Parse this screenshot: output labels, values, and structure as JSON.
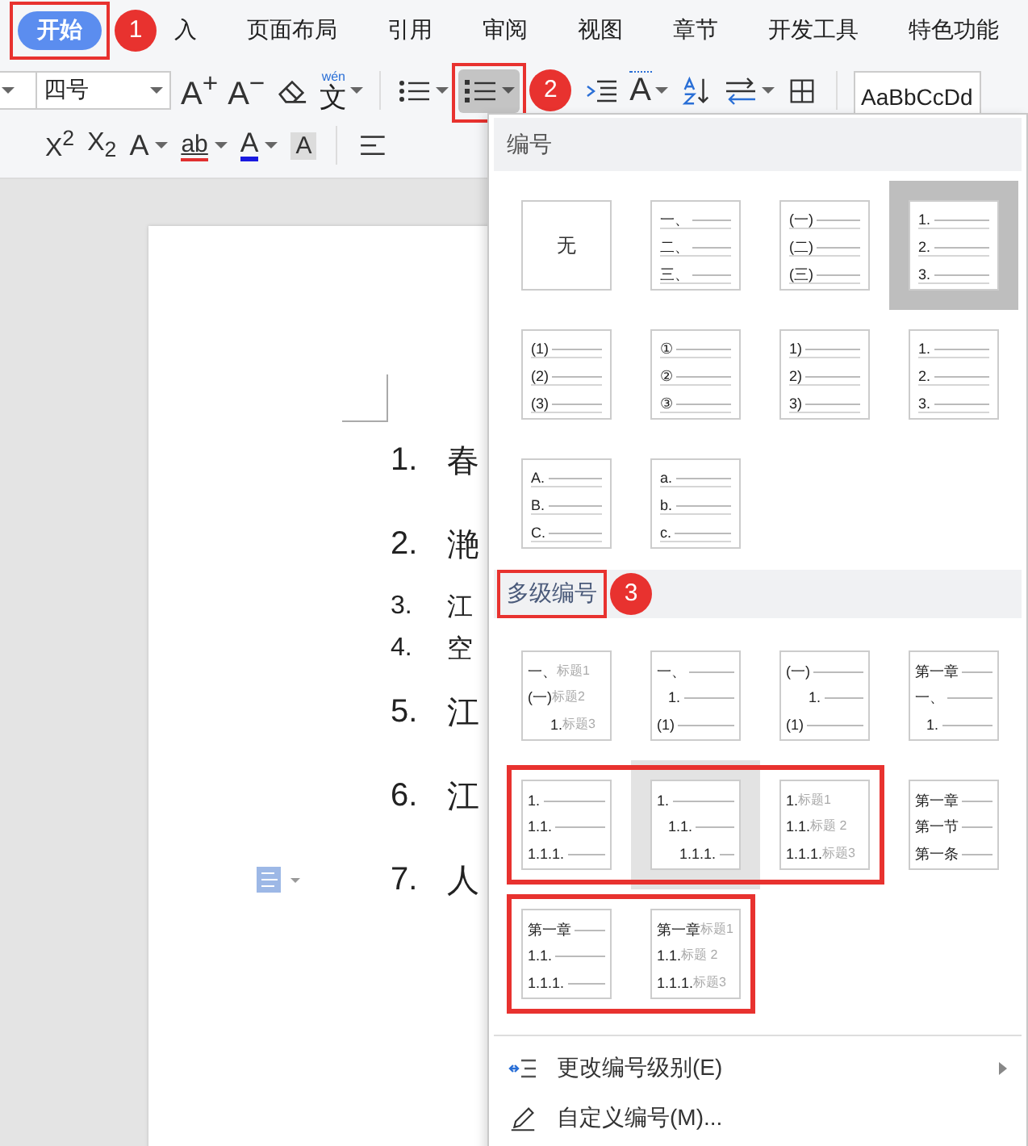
{
  "menu_tabs": [
    {
      "label": "开始",
      "selected": true,
      "annotated": true,
      "badge": "1"
    },
    {
      "label": "入",
      "selected": false,
      "annotated": false
    },
    {
      "label": "页面布局",
      "selected": false,
      "annotated": false
    },
    {
      "label": "引用",
      "selected": false,
      "annotated": false
    },
    {
      "label": "审阅",
      "selected": false,
      "annotated": false
    },
    {
      "label": "视图",
      "selected": false,
      "annotated": false
    },
    {
      "label": "章节",
      "selected": false,
      "annotated": false
    },
    {
      "label": "开发工具",
      "selected": false,
      "annotated": false
    },
    {
      "label": "特色功能",
      "selected": false,
      "annotated": false
    }
  ],
  "toolbar": {
    "font_size": "四号",
    "grow_font": "A$^{+}$",
    "shrink_font": "A$^{−}$",
    "pinyin": {
      "ruby": "wén",
      "text": "文"
    },
    "numbered_list": {
      "selected": true,
      "annotated": true,
      "badge": "2"
    },
    "text_direction": "A",
    "style_preview": "AaBbCcDd",
    "superscript": "X$^{2}$",
    "subscript": "X$_{2}$",
    "text_effect": "A",
    "highlight": "ab",
    "font_color": "A",
    "char_shading": "A"
  },
  "document": {
    "items": [
      {
        "number": "1.",
        "text": "春",
        "kind": "large",
        "handle": false
      },
      {
        "number": "2.",
        "text": "滟",
        "kind": "large",
        "handle": false
      },
      {
        "number": "3.",
        "text": "江",
        "kind": "small",
        "handle": false
      },
      {
        "number": "4.",
        "text": "空",
        "kind": "small",
        "handle": false
      },
      {
        "number": "5.",
        "text": "江",
        "kind": "large",
        "handle": false
      },
      {
        "number": "6.",
        "text": "江",
        "kind": "large",
        "handle": false
      },
      {
        "number": "7.",
        "text": "人",
        "kind": "large",
        "handle": true
      }
    ]
  },
  "numbering_menu": {
    "numbering_heading": "编号",
    "numbering_tiles": [
      {
        "kind": "none",
        "label": "无",
        "selected": false
      },
      {
        "kind": "list",
        "selected": false,
        "lines": [
          {
            "label": "一、",
            "kind": "level1"
          },
          {
            "label": "二、",
            "kind": "level1"
          },
          {
            "label": "三、",
            "kind": "level1"
          }
        ]
      },
      {
        "kind": "list",
        "selected": false,
        "lines": [
          {
            "label": "(一)",
            "kind": "level1"
          },
          {
            "label": "(二)",
            "kind": "level1"
          },
          {
            "label": "(三)",
            "kind": "level1"
          }
        ]
      },
      {
        "kind": "list",
        "selected": true,
        "lines": [
          {
            "label": "1.",
            "kind": "level1"
          },
          {
            "label": "2.",
            "kind": "level1"
          },
          {
            "label": "3.",
            "kind": "level1"
          }
        ]
      },
      {
        "kind": "list",
        "selected": false,
        "lines": [
          {
            "label": "(1)",
            "kind": "level1"
          },
          {
            "label": "(2)",
            "kind": "level1"
          },
          {
            "label": "(3)",
            "kind": "level1"
          }
        ]
      },
      {
        "kind": "list",
        "selected": false,
        "lines": [
          {
            "label": "①",
            "kind": "level1"
          },
          {
            "label": "②",
            "kind": "level1"
          },
          {
            "label": "③",
            "kind": "level1"
          }
        ]
      },
      {
        "kind": "list",
        "selected": false,
        "lines": [
          {
            "label": "1)",
            "kind": "level1"
          },
          {
            "label": "2)",
            "kind": "level1"
          },
          {
            "label": "3)",
            "kind": "level1"
          }
        ]
      },
      {
        "kind": "list",
        "selected": false,
        "lines": [
          {
            "label": "1.",
            "kind": "level1"
          },
          {
            "label": "2.",
            "kind": "level1"
          },
          {
            "label": "3.",
            "kind": "level1"
          }
        ]
      },
      {
        "kind": "list",
        "selected": false,
        "lines": [
          {
            "label": "A.",
            "kind": "level1"
          },
          {
            "label": "B.",
            "kind": "level1"
          },
          {
            "label": "C.",
            "kind": "level1"
          }
        ]
      },
      {
        "kind": "list",
        "selected": false,
        "lines": [
          {
            "label": "a.",
            "kind": "level1"
          },
          {
            "label": "b.",
            "kind": "level1"
          },
          {
            "label": "c.",
            "kind": "level1"
          }
        ]
      }
    ],
    "multilevel_heading": {
      "label": "多级编号",
      "annotated": true,
      "badge": "3"
    },
    "multilevel_rows": [
      {
        "groups": [
          {
            "annotated": false,
            "tiles": [
              {
                "hovered": false,
                "lines": [
                  {
                    "label": "一、",
                    "caption": "标题1",
                    "kind": "level1"
                  },
                  {
                    "label": "(一)",
                    "caption": "标题2",
                    "kind": "level1"
                  },
                  {
                    "label": "1.",
                    "caption": "标题3",
                    "kind": "level3"
                  }
                ]
              },
              {
                "hovered": false,
                "lines": [
                  {
                    "label": "一、",
                    "kind": "level1"
                  },
                  {
                    "label": "1.",
                    "kind": "level2"
                  },
                  {
                    "label": "(1)",
                    "kind": "level1"
                  }
                ]
              },
              {
                "hovered": false,
                "lines": [
                  {
                    "label": "(一)",
                    "kind": "level1"
                  },
                  {
                    "label": "1.",
                    "kind": "level3"
                  },
                  {
                    "label": "(1)",
                    "kind": "level1"
                  }
                ]
              },
              {
                "hovered": false,
                "lines": [
                  {
                    "label": "第一章",
                    "kind": "level1"
                  },
                  {
                    "label": "一、",
                    "kind": "level1"
                  },
                  {
                    "label": "1.",
                    "kind": "level2"
                  }
                ]
              }
            ]
          }
        ]
      },
      {
        "groups": [
          {
            "annotated": true,
            "tiles": [
              {
                "hovered": false,
                "lines": [
                  {
                    "label": "1.",
                    "kind": "level1"
                  },
                  {
                    "label": "1.1.",
                    "kind": "level1"
                  },
                  {
                    "label": "1.1.1.",
                    "kind": "level1"
                  }
                ]
              },
              {
                "hovered": true,
                "lines": [
                  {
                    "label": "1.",
                    "kind": "level1"
                  },
                  {
                    "label": "1.1.",
                    "kind": "level2"
                  },
                  {
                    "label": "1.1.1.",
                    "kind": "level3"
                  }
                ]
              },
              {
                "hovered": false,
                "lines": [
                  {
                    "label": "1.",
                    "caption": "标题1",
                    "kind": "level1"
                  },
                  {
                    "label": "1.1.",
                    "caption": "标题 2",
                    "kind": "level1"
                  },
                  {
                    "label": "1.1.1.",
                    "caption": "标题3",
                    "kind": "level1"
                  }
                ]
              }
            ]
          },
          {
            "annotated": false,
            "tiles": [
              {
                "hovered": false,
                "lines": [
                  {
                    "label": "第一章",
                    "kind": "level1"
                  },
                  {
                    "label": "第一节",
                    "kind": "level1"
                  },
                  {
                    "label": "第一条",
                    "kind": "level1"
                  }
                ]
              }
            ]
          }
        ]
      },
      {
        "groups": [
          {
            "annotated": true,
            "tiles": [
              {
                "hovered": false,
                "lines": [
                  {
                    "label": "第一章",
                    "kind": "level1"
                  },
                  {
                    "label": "1.1.",
                    "kind": "level1"
                  },
                  {
                    "label": "1.1.1.",
                    "kind": "level1"
                  }
                ]
              },
              {
                "hovered": false,
                "lines": [
                  {
                    "label": "第一章",
                    "caption": "标题1",
                    "kind": "level1"
                  },
                  {
                    "label": "1.1.",
                    "caption": "标题 2",
                    "kind": "level1"
                  },
                  {
                    "label": "1.1.1.",
                    "caption": "标题3",
                    "kind": "level1"
                  }
                ]
              }
            ]
          }
        ]
      }
    ],
    "commands": [
      {
        "label": "更改编号级别(E)",
        "kind": "levels",
        "submenu": true
      },
      {
        "label": "自定义编号(M)...",
        "kind": "pen",
        "submenu": false
      }
    ]
  }
}
